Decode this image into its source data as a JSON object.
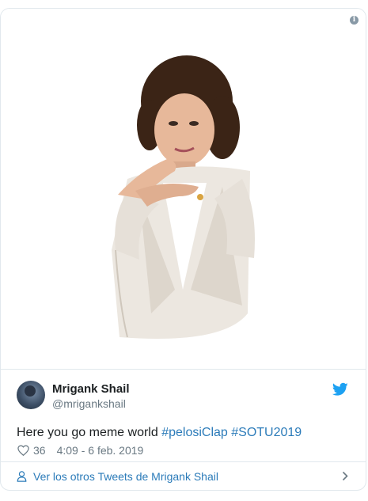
{
  "tweet": {
    "author_name": "Mrigank Shail",
    "author_handle": "@mrigankshail",
    "text_plain": "Here you go meme world ",
    "hashtags": [
      "#pelosiClap",
      "#SOTU2019"
    ],
    "likes": "36",
    "timestamp": "4:09 - 6 feb. 2019"
  },
  "footer": {
    "link_label": "Ver los otros Tweets de Mrigank Shail"
  },
  "icons": {
    "info": "info-icon",
    "bird": "twitter-bird-icon",
    "heart": "heart-icon",
    "user": "user-icon",
    "chevron": "chevron-right-icon"
  },
  "colors": {
    "link": "#2b7bb9",
    "twitter_blue": "#1da1f2",
    "secondary_text": "#697882",
    "border": "#e1e8ed"
  }
}
